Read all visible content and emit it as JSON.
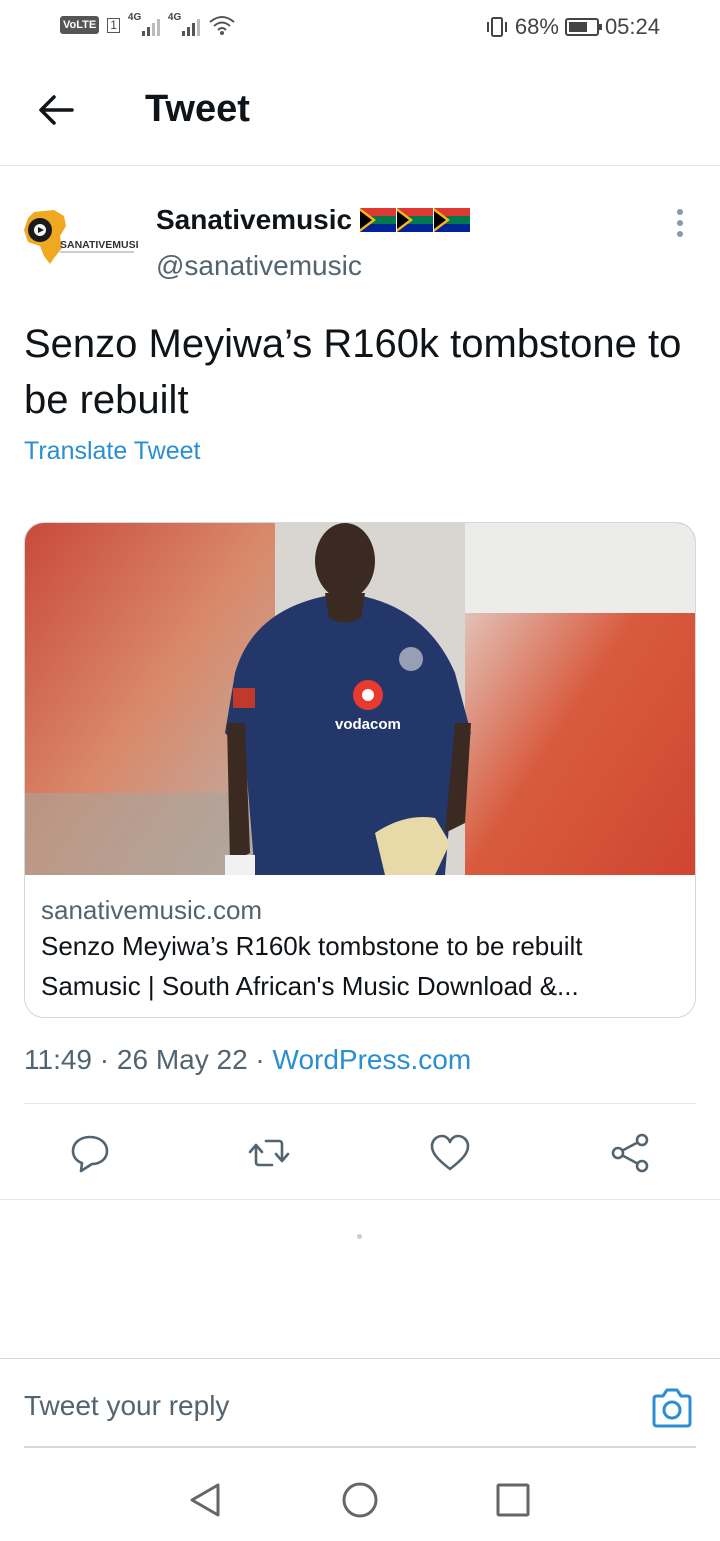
{
  "status_bar": {
    "volte": "VoLTE",
    "sim": "1",
    "net1": "4G",
    "net2": "4G",
    "battery": "68%",
    "battery_level": 0.68,
    "time": "05:24"
  },
  "header": {
    "title": "Tweet"
  },
  "tweet": {
    "avatar_text": "SANATIVEMUSIC",
    "author_name": "Sanativemusic",
    "author_handle": "@sanativemusic",
    "text": "Senzo Meyiwa’s R160k tombstone to be rebuilt",
    "translate_label": "Translate Tweet",
    "time": "11:49",
    "date": "26 May 22",
    "source": "WordPress.com",
    "separator": "·"
  },
  "card": {
    "jersey_brand": "vodacom",
    "domain": "sanativemusic.com",
    "title": "Senzo Meyiwa’s R160k tombstone to be rebuilt",
    "description": "Samusic | South African's Music Download &..."
  },
  "reply": {
    "placeholder": "Tweet your reply"
  },
  "icons": {
    "back": "arrow-left-icon",
    "more": "more-vertical-icon",
    "reply": "comment-icon",
    "retweet": "retweet-icon",
    "like": "heart-icon",
    "share": "share-icon",
    "camera": "camera-icon",
    "nav_back": "triangle-back-icon",
    "nav_home": "circle-home-icon",
    "nav_recents": "square-recents-icon"
  },
  "colors": {
    "link": "#2a8fd0",
    "text": "#0f1419",
    "muted": "#536471",
    "divider": "#e1e8ed"
  }
}
